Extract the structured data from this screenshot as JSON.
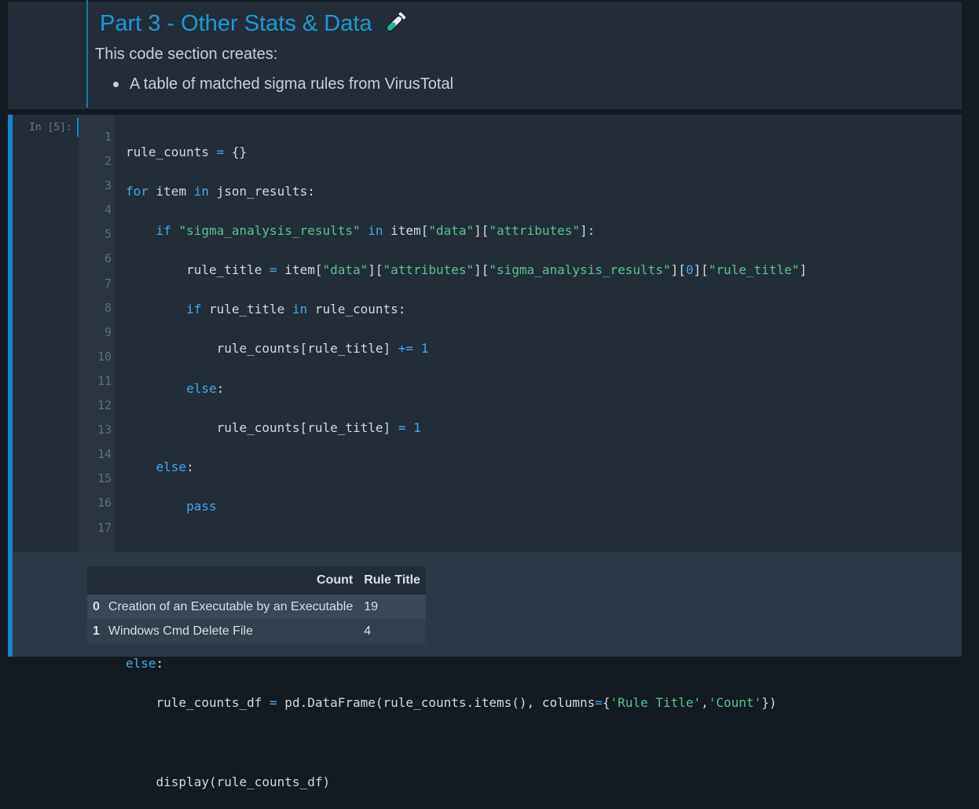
{
  "markdown": {
    "title": "Part 3 - Other Stats & Data",
    "title_icon": "test-tube-icon",
    "intro": "This code section creates:",
    "bullets": [
      "A table of matched sigma rules from VirusTotal"
    ]
  },
  "code_cell": {
    "prompt": "In [5]:",
    "line_numbers": [
      "1",
      "2",
      "3",
      "4",
      "5",
      "6",
      "7",
      "8",
      "9",
      "10",
      "11",
      "12",
      "13",
      "14",
      "15",
      "16",
      "17"
    ]
  },
  "output": {
    "columns": [
      "Count",
      "Rule Title"
    ],
    "rows": [
      {
        "index": "0",
        "count": "Creation of an Executable by an Executable",
        "rule_title": "19"
      },
      {
        "index": "1",
        "count": "Windows Cmd Delete File",
        "rule_title": "4"
      }
    ]
  },
  "colors": {
    "accent": "#1488c9",
    "title": "#1a9ad6",
    "keyword": "#46a5e8",
    "string": "#58c28c",
    "builtin": "#e06c75"
  }
}
